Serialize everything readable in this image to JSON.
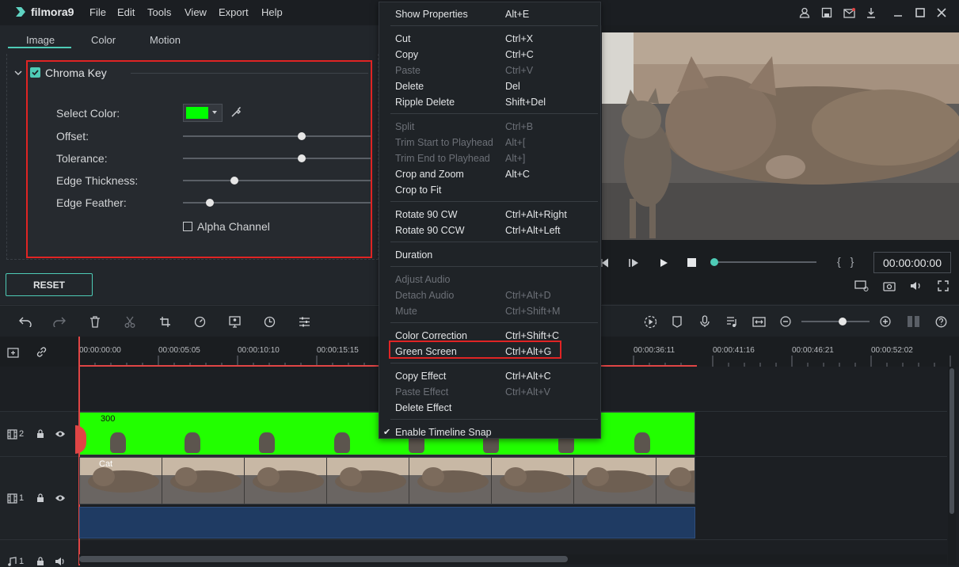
{
  "app": {
    "name": "filmora9"
  },
  "menu": [
    "File",
    "Edit",
    "Tools",
    "View",
    "Export",
    "Help"
  ],
  "panel": {
    "tabs": [
      "Image",
      "Color",
      "Motion"
    ],
    "section_title": "Chroma Key",
    "labels": {
      "select_color": "Select Color:",
      "offset": "Offset:",
      "tolerance": "Tolerance:",
      "edge_thickness": "Edge Thickness:",
      "edge_feather": "Edge Feather:"
    },
    "slider_levels": {
      "offset": 0.62,
      "tolerance": 0.62,
      "edge_thickness": 0.27,
      "edge_feather": 0.14
    },
    "alpha_channel": "Alpha Channel",
    "reset": "RESET",
    "key_color": "#00ff00"
  },
  "context_menu": [
    {
      "label": "Show Properties",
      "key": "Alt+E",
      "disabled": false
    },
    {
      "label": "Cut",
      "key": "Ctrl+X",
      "disabled": false
    },
    {
      "label": "Copy",
      "key": "Ctrl+C",
      "disabled": false
    },
    {
      "label": "Paste",
      "key": "Ctrl+V",
      "disabled": true
    },
    {
      "label": "Delete",
      "key": "Del",
      "disabled": false
    },
    {
      "label": "Ripple Delete",
      "key": "Shift+Del",
      "disabled": false
    },
    {
      "label": "Split",
      "key": "Ctrl+B",
      "disabled": true
    },
    {
      "label": "Trim Start to Playhead",
      "key": "Alt+[",
      "disabled": true
    },
    {
      "label": "Trim End to Playhead",
      "key": "Alt+]",
      "disabled": true
    },
    {
      "label": "Crop and Zoom",
      "key": "Alt+C",
      "disabled": false
    },
    {
      "label": "Crop to Fit",
      "key": "",
      "disabled": false
    },
    {
      "label": "Rotate 90 CW",
      "key": "Ctrl+Alt+Right",
      "disabled": false
    },
    {
      "label": "Rotate 90 CCW",
      "key": "Ctrl+Alt+Left",
      "disabled": false
    },
    {
      "label": "Duration",
      "key": "",
      "disabled": false
    },
    {
      "label": "Adjust Audio",
      "key": "",
      "disabled": true
    },
    {
      "label": "Detach Audio",
      "key": "Ctrl+Alt+D",
      "disabled": true
    },
    {
      "label": "Mute",
      "key": "Ctrl+Shift+M",
      "disabled": true
    },
    {
      "label": "Color Correction",
      "key": "Ctrl+Shift+C",
      "disabled": false
    },
    {
      "label": "Green Screen",
      "key": "Ctrl+Alt+G",
      "disabled": false
    },
    {
      "label": "Copy Effect",
      "key": "Ctrl+Alt+C",
      "disabled": false
    },
    {
      "label": "Paste Effect",
      "key": "Ctrl+Alt+V",
      "disabled": true
    },
    {
      "label": "Delete Effect",
      "key": "",
      "disabled": false
    },
    {
      "label": "Enable Timeline Snap",
      "key": "",
      "disabled": false
    }
  ],
  "player": {
    "timecode": "00:00:00:00",
    "brackets": "{ }"
  },
  "timeline": {
    "ruler": [
      "00:00:00:00",
      "00:00:05:05",
      "00:00:10:10",
      "00:00:15:15",
      "00:00:36:11",
      "00:00:41:16",
      "00:00:46:21",
      "00:00:52:02"
    ],
    "tracks": [
      "2",
      "1",
      "1"
    ],
    "clip2_label": "300",
    "clip1_label": "Cat"
  }
}
